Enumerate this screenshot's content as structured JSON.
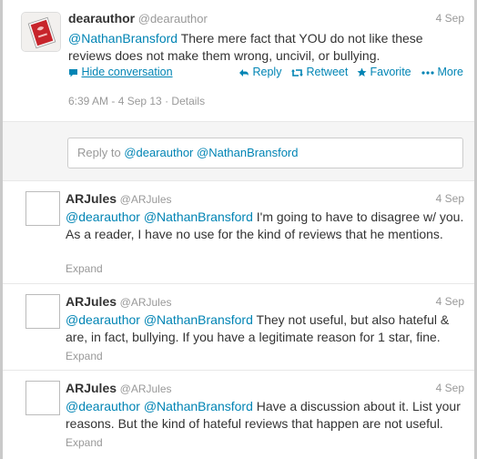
{
  "main_tweet": {
    "fullname": "dearauthor",
    "username": "@dearauthor",
    "time": "4 Sep",
    "mention": "@NathanBransford",
    "text": " There mere fact that YOU do not like these reviews does not make them wrong, uncivil, or bullying.",
    "hide_conversation": "Hide conversation",
    "actions": {
      "reply": "Reply",
      "retweet": "Retweet",
      "favorite": "Favorite",
      "more": "More"
    },
    "timestamp": "6:39 AM - 4 Sep 13",
    "details": "Details",
    "details_sep": " · "
  },
  "reply_box": {
    "prefix": "Reply to ",
    "mentions": "@dearauthor @NathanBransford"
  },
  "replies": [
    {
      "fullname": "ARJules",
      "username": "@ARJules",
      "time": "4 Sep",
      "mentions": "@dearauthor @NathanBransford",
      "text": " I'm going to have to disagree w/ you. As a reader, I have no use for the kind of reviews that he mentions.",
      "expand": "Expand"
    },
    {
      "fullname": "ARJules",
      "username": "@ARJules",
      "time": "4 Sep",
      "mentions": "@dearauthor @NathanBransford",
      "text": " They not useful, but also hateful & are, in fact, bullying. If you have a legitimate reason for 1 star, fine.",
      "expand": "Expand"
    },
    {
      "fullname": "ARJules",
      "username": "@ARJules",
      "time": "4 Sep",
      "mentions": "@dearauthor @NathanBransford",
      "text": " Have a discussion about it. List your reasons. But the kind of hateful reviews that happen are not useful.",
      "expand": "Expand"
    }
  ],
  "colors": {
    "link": "#0084b4",
    "muted": "#999999",
    "text": "#333333"
  },
  "icons": [
    "avatar-book-icon",
    "chat-bubble-icon",
    "reply-arrow-icon",
    "retweet-icon",
    "star-icon",
    "more-dots-icon"
  ]
}
